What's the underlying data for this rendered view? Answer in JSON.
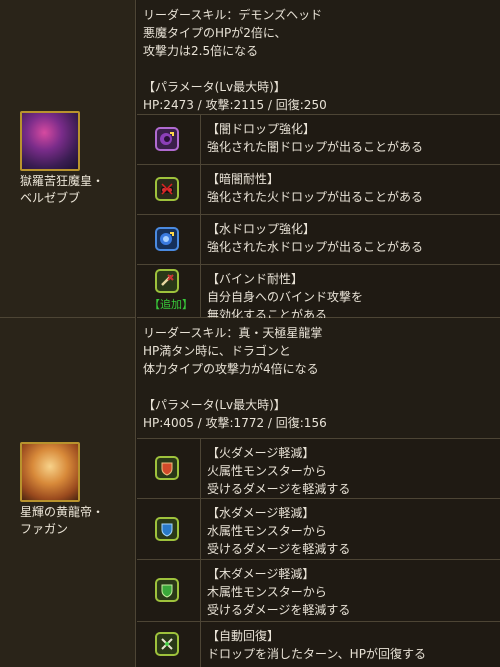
{
  "monsters": [
    {
      "name_lines": [
        "獄羅苦狂魔皇・",
        "ベルゼブブ"
      ],
      "leader_skill": {
        "lines": [
          "リーダースキル：デモンズヘッド",
          "悪魔タイプのHPが2倍に、",
          "攻撃力は2.5倍になる"
        ],
        "param_title": "【パラメータ(Lv最大時)】",
        "params": "HP:2473 / 攻撃:2115 / 回復:250"
      },
      "awakenings": [
        {
          "icon": "dark-drop-enhance-icon",
          "title": "【闇ドロップ強化】",
          "desc": [
            "強化された闇ドロップが出ることがある"
          ]
        },
        {
          "icon": "dark-resist-icon",
          "title": "【暗闇耐性】",
          "desc": [
            "強化された火ドロップが出ることがある"
          ]
        },
        {
          "icon": "water-drop-enhance-icon",
          "title": "【水ドロップ強化】",
          "desc": [
            "強化された水ドロップが出ることがある"
          ]
        },
        {
          "icon": "bind-resist-icon",
          "badge": "【追加】",
          "title": "【バインド耐性】",
          "desc": [
            "自分自身へのバインド攻撃を",
            "無効化することがある"
          ]
        }
      ]
    },
    {
      "name_lines": [
        "星輝の黄龍帝・",
        "ファガン"
      ],
      "leader_skill": {
        "lines": [
          "リーダースキル：真・天極星龍掌",
          "HP満タン時に、ドラゴンと",
          "体力タイプの攻撃力が4倍になる"
        ],
        "param_title": "【パラメータ(Lv最大時)】",
        "params": "HP:4005 / 攻撃:1772 / 回復:156"
      },
      "awakenings": [
        {
          "icon": "fire-damage-reduce-icon",
          "title": "【火ダメージ軽減】",
          "desc": [
            "火属性モンスターから",
            "受けるダメージを軽減する"
          ]
        },
        {
          "icon": "water-damage-reduce-icon",
          "title": "【水ダメージ軽減】",
          "desc": [
            "水属性モンスターから",
            "受けるダメージを軽減する"
          ]
        },
        {
          "icon": "wood-damage-reduce-icon",
          "title": "【木ダメージ軽減】",
          "desc": [
            "木属性モンスターから",
            "受けるダメージを軽減する"
          ]
        },
        {
          "icon": "auto-recover-icon",
          "title": "【自動回復】",
          "desc": [
            "ドロップを消したターン、HPが回復する"
          ]
        }
      ]
    }
  ],
  "colors": {
    "background": "#1f1a13",
    "border": "#4d4535",
    "text": "#e8e2d6",
    "badge": "#38c93a",
    "icon_border": "#9ec23c"
  }
}
